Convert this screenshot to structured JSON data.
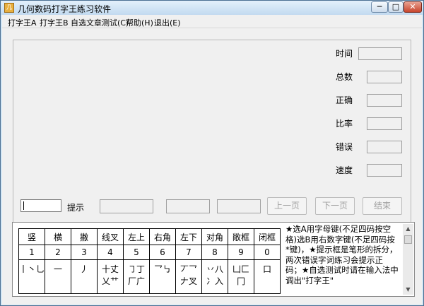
{
  "window": {
    "title": "几何数码打字王练习软件",
    "app_icon": "几",
    "min_label": "─",
    "max_label": "□",
    "close_label": "✕"
  },
  "menu": [
    "打字王A",
    "打字王B",
    "自选文章测试(C)",
    "帮助(H)",
    "退出(E)"
  ],
  "stats": {
    "labels": [
      "时间",
      "总数",
      "正确",
      "比率",
      "错误",
      "速度"
    ]
  },
  "controls": {
    "hint_label": "提示",
    "prev_page": "上一页",
    "next_page": "下一页",
    "end": "结束"
  },
  "reference": {
    "headers": [
      "竖",
      "横",
      "撇",
      "线叉",
      "左上",
      "右角",
      "左下",
      "对角",
      "敞框",
      "闭框"
    ],
    "numbers": [
      "1",
      "2",
      "3",
      "4",
      "5",
      "6",
      "7",
      "8",
      "9",
      "0"
    ],
    "components": [
      "丨丶乚",
      "一",
      "丿",
      "十丈\n乂艹",
      "㇆丁\n厂广",
      "乛㇉",
      "丆乛\n𠂇叉",
      "丷八\n冫入",
      "凵匚\n冂",
      "口"
    ]
  },
  "notes": "★选A用字母键(不足四码按空格)选B用右数字键(不足四码按*键)，★提示框是笔形的拆分，两次错误字词练习会提示正码；★自选测试时请在输入法中调出\"打字王\""
}
